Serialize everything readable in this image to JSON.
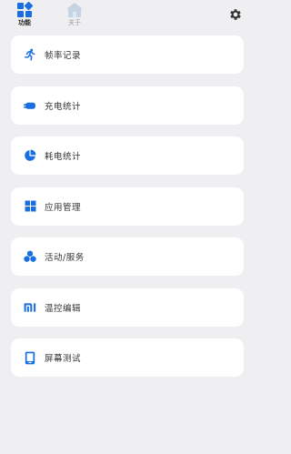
{
  "header": {
    "tabs": [
      {
        "label": "功能",
        "active": true,
        "icon": "grid-icon"
      },
      {
        "label": "关于",
        "active": false,
        "icon": "home-icon"
      }
    ],
    "settings_icon": "gear-icon"
  },
  "colors": {
    "accent": "#1a6fe0",
    "background": "#efeff1",
    "card": "#ffffff",
    "inactive": "#b9c7d9"
  },
  "menu": [
    {
      "label": "帧率记录",
      "icon": "running-person-icon"
    },
    {
      "label": "充电统计",
      "icon": "charging-icon"
    },
    {
      "label": "耗电统计",
      "icon": "pie-chart-icon"
    },
    {
      "label": "应用管理",
      "icon": "app-grid-icon"
    },
    {
      "label": "活动/服务",
      "icon": "activity-icon"
    },
    {
      "label": "温控编辑",
      "icon": "mi-logo-icon"
    },
    {
      "label": "屏幕测试",
      "icon": "phone-screen-icon"
    }
  ]
}
